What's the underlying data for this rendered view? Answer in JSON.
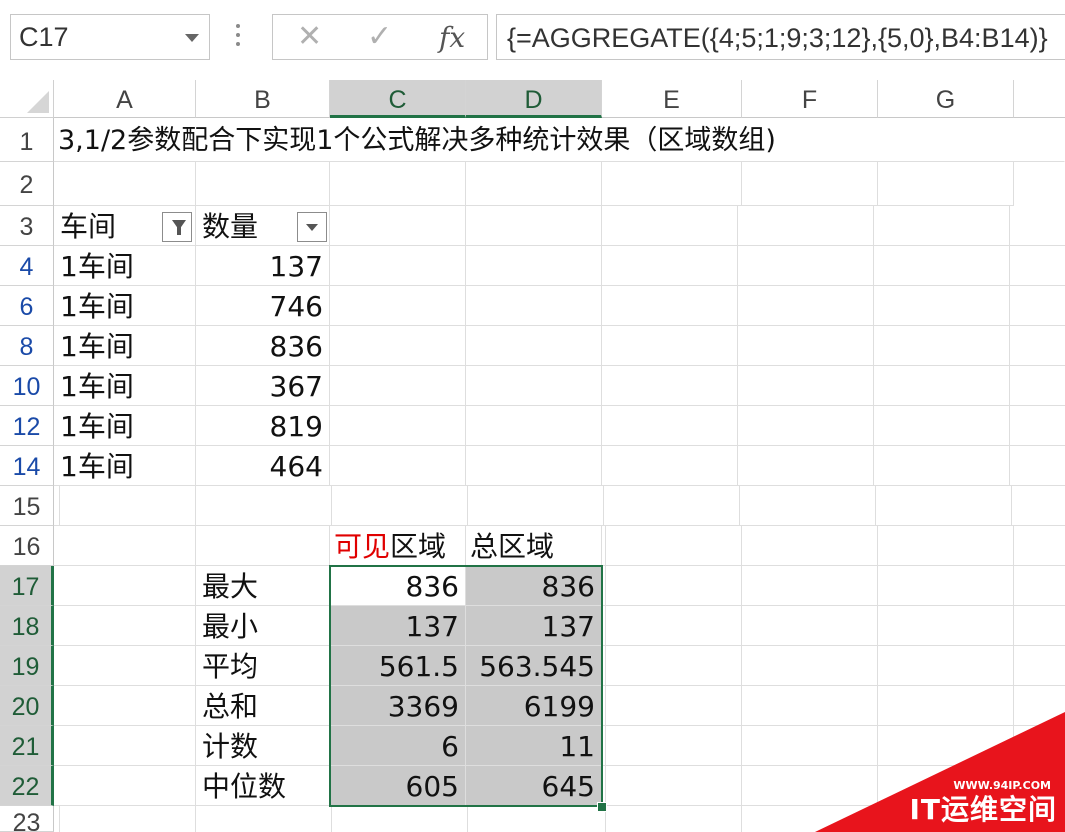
{
  "formula_bar": {
    "name_box": "C17",
    "cancel_icon": "✕",
    "enter_icon": "✓",
    "fx_label": "fx",
    "formula": "{=AGGREGATE({4;5;1;9;3;12},{5,0},B4:B14)}"
  },
  "columns": [
    "A",
    "B",
    "C",
    "D",
    "E",
    "F",
    "G"
  ],
  "rows": {
    "r1": {
      "header": "1",
      "A": "3,1/2参数配合下实现1个公式解决多种统计效果（区域数组)"
    },
    "r2": {
      "header": "2"
    },
    "r3": {
      "header": "3",
      "A": "车间",
      "B": "数量"
    },
    "r4": {
      "header": "4",
      "A": "1车间",
      "B": "137"
    },
    "r6": {
      "header": "6",
      "A": "1车间",
      "B": "746"
    },
    "r8": {
      "header": "8",
      "A": "1车间",
      "B": "836"
    },
    "r10": {
      "header": "10",
      "A": "1车间",
      "B": "367"
    },
    "r12": {
      "header": "12",
      "A": "1车间",
      "B": "819"
    },
    "r14": {
      "header": "14",
      "A": "1车间",
      "B": "464"
    },
    "r15": {
      "header": "15"
    },
    "r16": {
      "header": "16",
      "C_red": "可见",
      "C_rest": "区域",
      "D": "总区域"
    },
    "r17": {
      "header": "17",
      "B": "最大",
      "C": "836",
      "D": "836"
    },
    "r18": {
      "header": "18",
      "B": "最小",
      "C": "137",
      "D": "137"
    },
    "r19": {
      "header": "19",
      "B": "平均",
      "C": "561.5",
      "D": "563.545"
    },
    "r20": {
      "header": "20",
      "B": "总和",
      "C": "3369",
      "D": "6199"
    },
    "r21": {
      "header": "21",
      "B": "计数",
      "C": "6",
      "D": "11"
    },
    "r22": {
      "header": "22",
      "B": "中位数",
      "C": "605",
      "D": "645"
    },
    "r23": {
      "header": "23"
    }
  },
  "watermark": {
    "url": "WWW.94IP.COM",
    "text": "IT运维空间"
  },
  "colors": {
    "selection": "#217346",
    "highlight": "#c9c9c9",
    "red_text": "#e00000",
    "watermark": "#e8141c"
  }
}
